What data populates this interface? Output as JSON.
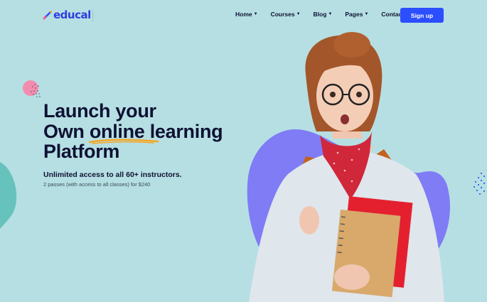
{
  "brand": {
    "name": "educal"
  },
  "nav": {
    "items": [
      {
        "label": "Home",
        "dropdown": true
      },
      {
        "label": "Courses",
        "dropdown": true
      },
      {
        "label": "Blog",
        "dropdown": true
      },
      {
        "label": "Pages",
        "dropdown": true
      },
      {
        "label": "Contact",
        "dropdown": false
      }
    ],
    "cta": "Sign up"
  },
  "hero": {
    "title_line1": "Launch your",
    "title_line2_a": "Own ",
    "title_line2_highlight": "online",
    "title_line2_b": " learning",
    "title_line3": "Platform",
    "subtitle": "Unlimited access to all 60+ instructors.",
    "note": "2 passes (with access to all classes) for $240"
  },
  "colors": {
    "background": "#b6dfe3",
    "accent": "#2b4eff",
    "heading": "#0e1133",
    "blob": "#7f7cf5",
    "underline": "#f5a623"
  }
}
